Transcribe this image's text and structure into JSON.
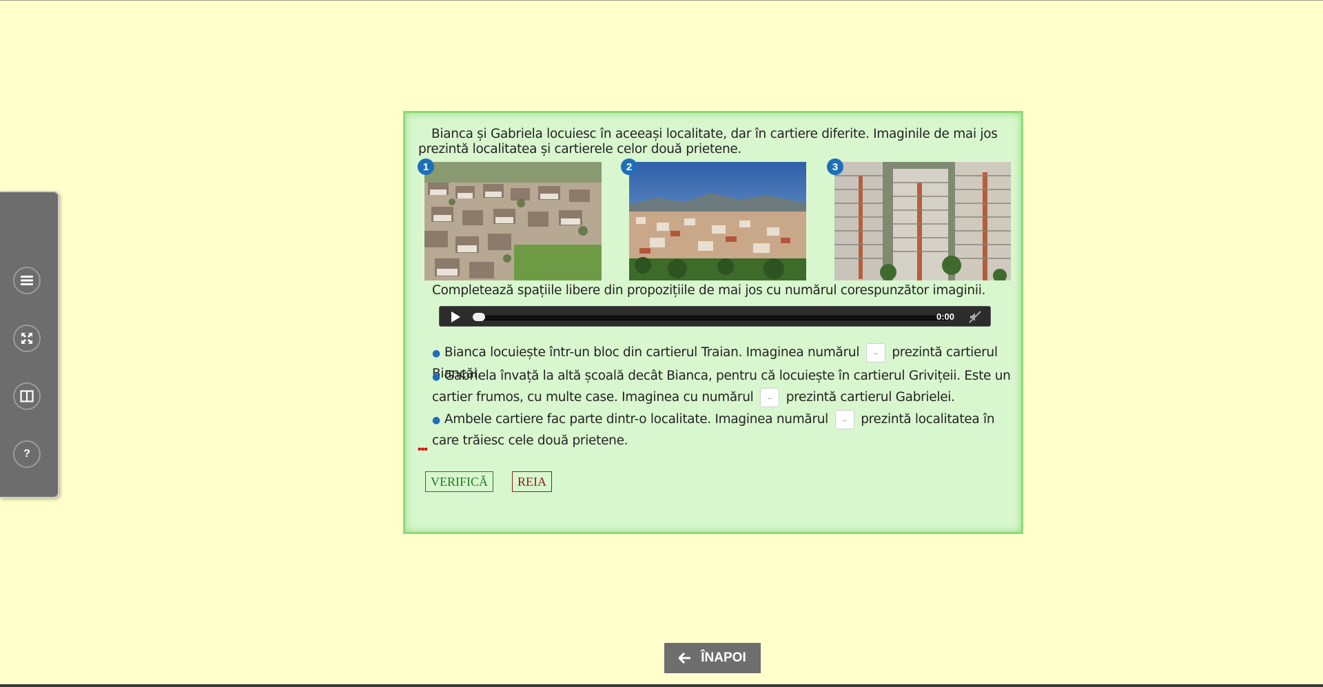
{
  "sidebar": {
    "buttons": [
      {
        "icon": "menu-icon"
      },
      {
        "icon": "fullscreen-icon"
      },
      {
        "icon": "split-view-icon"
      },
      {
        "icon": "help-icon",
        "label": "?"
      }
    ]
  },
  "lesson": {
    "intro": "Bianca și Gabriela locuiesc în aceeași localitate, dar în cartiere diferite. Imaginile de mai jos prezintă localitatea și cartierele celor două prietene.",
    "images": [
      {
        "number": "1",
        "subject": "suburban houses neighborhood"
      },
      {
        "number": "2",
        "subject": "city panorama with mountains"
      },
      {
        "number": "3",
        "subject": "apartment blocks"
      }
    ],
    "instruction": "Completează spațiile libere din propozițiile de mai jos cu numărul corespunzător imaginii.",
    "audio": {
      "time": "0:00",
      "progress": 0
    },
    "sentences": [
      {
        "before": "Bianca locuiește într-un bloc din cartierul Traian. Imaginea numărul",
        "blank": "..",
        "after": "prezintă cartierul Biancăi."
      },
      {
        "before": "Gabriela învață la altă școală decât Bianca, pentru că locuiește în cartierul Grivițeii. Este un cartier frumos, cu multe case. Imaginea cu numărul",
        "blank": "..",
        "after": "prezintă cartierul Gabrielei."
      },
      {
        "before": "Ambele cartiere fac parte dintr-o localitate. Imaginea numărul",
        "blank": "..",
        "after": "prezintă localitatea în care trăiesc cele două prietene."
      }
    ],
    "indicator": "•••",
    "verify_label": "VERIFICĂ",
    "reset_label": "REIA"
  },
  "nav": {
    "back_label": "ÎNAPOI"
  },
  "colors": {
    "background": "#ffffcc",
    "card": "#d9f7cf",
    "card_border": "#8fd977",
    "badge": "#1f6fb8",
    "verify": "#1f7a1f",
    "reset": "#8b1a1a"
  }
}
